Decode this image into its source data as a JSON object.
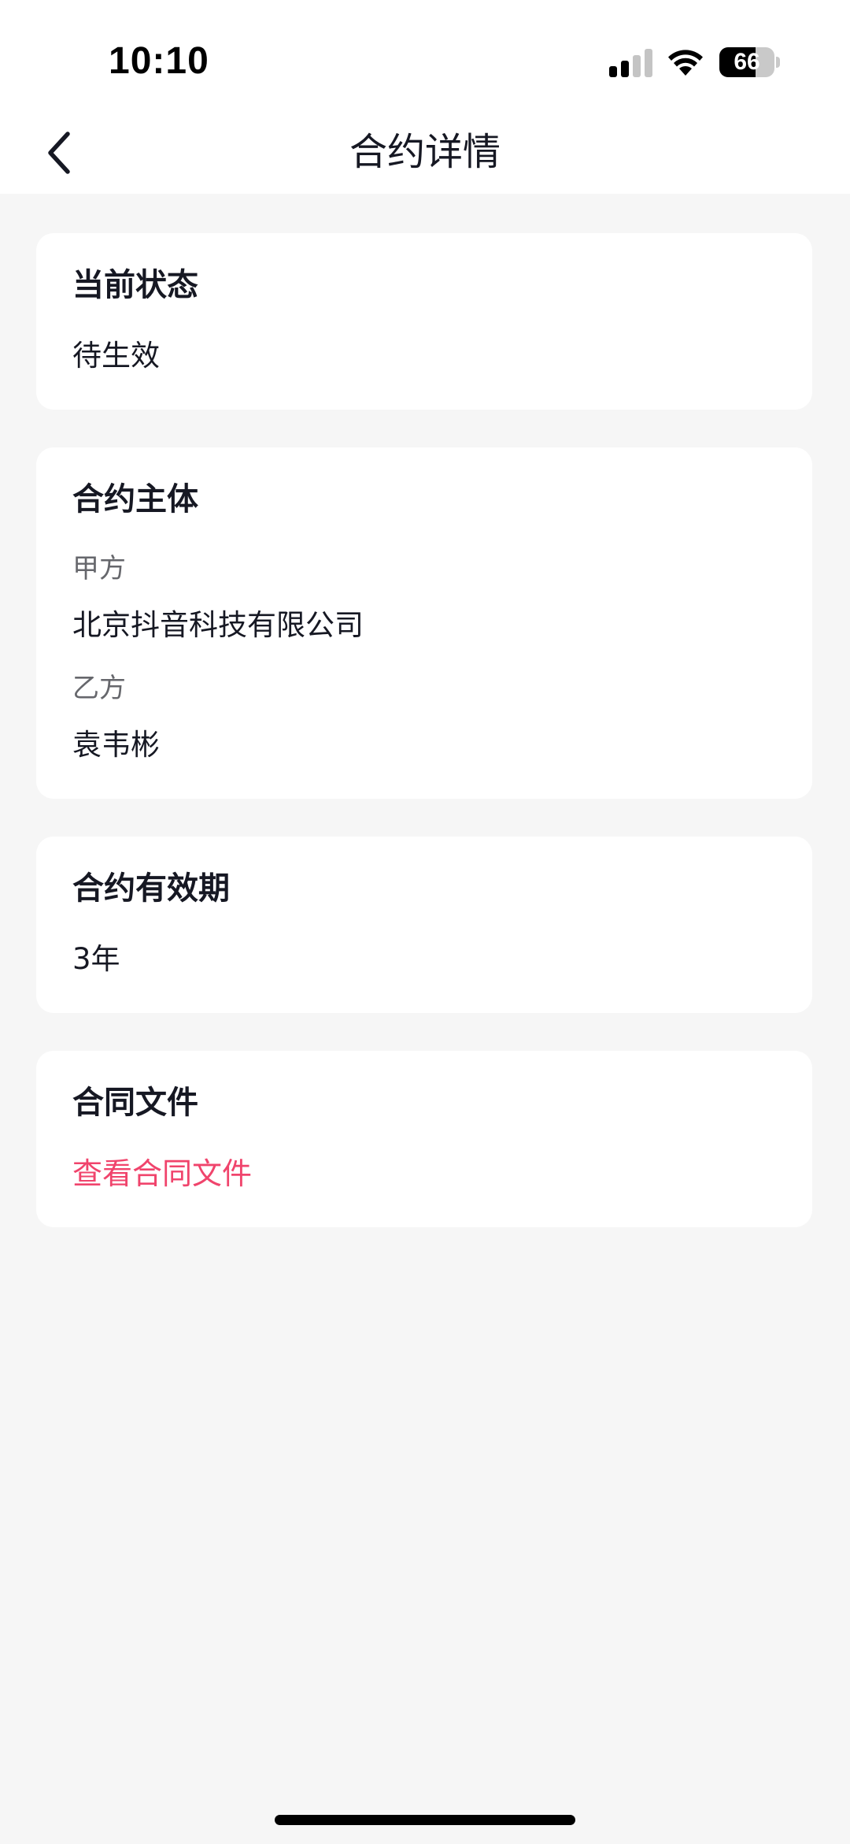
{
  "status_bar": {
    "time": "10:10",
    "battery_level": "66",
    "signal_icon": "cellular-signal-icon",
    "wifi_icon": "wifi-icon",
    "battery_icon": "battery-icon"
  },
  "nav": {
    "back_icon": "chevron-left-icon",
    "title": "合约详情"
  },
  "cards": {
    "status": {
      "title": "当前状态",
      "value": "待生效"
    },
    "parties": {
      "title": "合约主体",
      "party_a_label": "甲方",
      "party_a_value": "北京抖音科技有限公司",
      "party_b_label": "乙方",
      "party_b_value": "袁韦彬"
    },
    "validity": {
      "title": "合约有效期",
      "value": "3年"
    },
    "document": {
      "title": "合同文件",
      "link": "查看合同文件"
    }
  },
  "colors": {
    "page_background": "#f6f6f6",
    "card_background": "#ffffff",
    "primary_text": "#161823",
    "secondary_text": "#66676c",
    "accent_link": "#f0446c"
  }
}
